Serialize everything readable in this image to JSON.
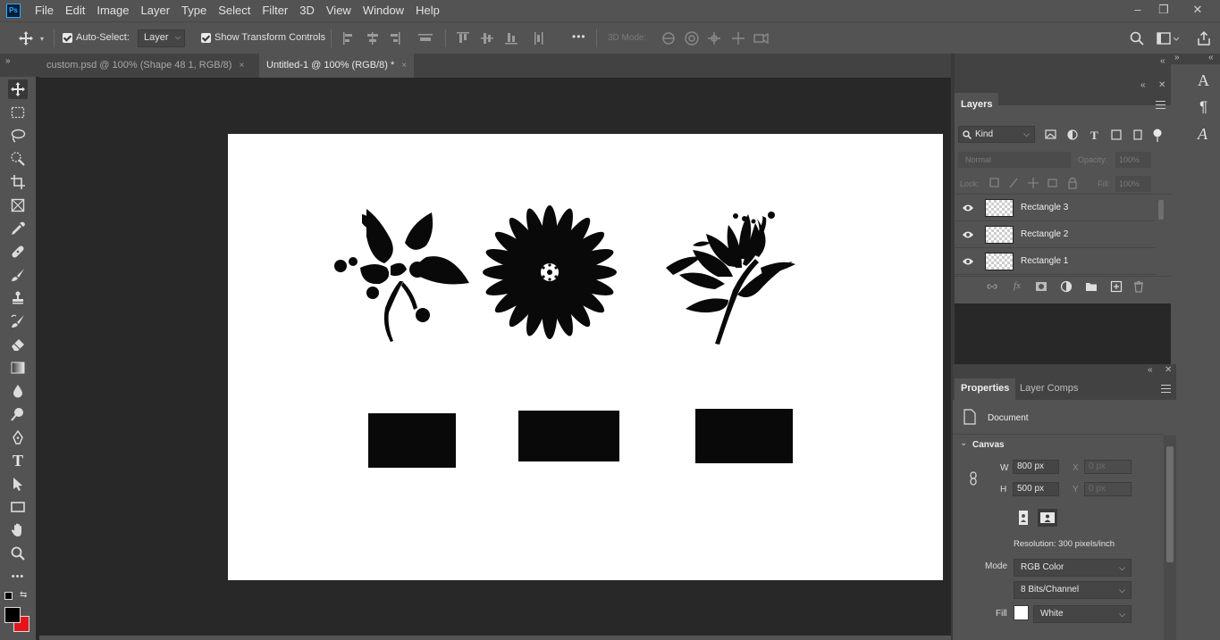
{
  "menubar": {
    "app_icon": "Ps",
    "items": [
      "File",
      "Edit",
      "Image",
      "Layer",
      "Type",
      "Select",
      "Filter",
      "3D",
      "View",
      "Window",
      "Help"
    ],
    "controls": [
      "minimize-icon",
      "restore-icon",
      "close-icon"
    ]
  },
  "options": {
    "auto_select_label": "Auto-Select:",
    "auto_select_checked": true,
    "auto_select_target": "Layer",
    "transform_label": "Show Transform Controls",
    "transform_checked": true,
    "more_label": "•••",
    "mode_3d_label": "3D Mode:"
  },
  "tabs": [
    {
      "label": "custom.psd @ 100% (Shape 48 1, RGB/8)",
      "close": "×",
      "active": false
    },
    {
      "label": "Untitled-1 @ 100% (RGB/8) *",
      "close": "×",
      "active": true
    }
  ],
  "toolbar": {
    "tools": [
      "move-tool",
      "marquee-tool",
      "lasso-tool",
      "quick-select-tool",
      "crop-tool",
      "frame-tool",
      "eyedropper-tool",
      "healing-tool",
      "brush-tool",
      "stamp-tool",
      "history-brush-tool",
      "eraser-tool",
      "gradient-tool",
      "blur-tool",
      "dodge-tool",
      "pen-tool",
      "type-tool",
      "path-select-tool",
      "rectangle-tool",
      "hand-tool",
      "zoom-tool",
      "more-tools"
    ],
    "type_glyph": "T",
    "more_glyph": "•••",
    "foreground_color": "#000000",
    "background_color": "#e3141b"
  },
  "document": {
    "shapes": [
      "leaf-flower-shape",
      "daisy-flower-shape",
      "lily-flower-shape"
    ],
    "rectangles": [
      "Rectangle 1",
      "Rectangle 2",
      "Rectangle 3"
    ],
    "rect_color": "#0a090a"
  },
  "layers": {
    "title": "Layers",
    "filter_kind": "Kind",
    "blend_mode": "Normal",
    "opacity_label": "Opacity:",
    "opacity_value": "100%",
    "lock_label": "Lock:",
    "fill_label": "Fill:",
    "fill_value": "100%",
    "items": [
      {
        "name": "Rectangle 3"
      },
      {
        "name": "Rectangle 2"
      },
      {
        "name": "Rectangle 1"
      }
    ],
    "fx_label": "fx"
  },
  "properties": {
    "tabs": [
      "Properties",
      "Layer Comps"
    ],
    "doc_label": "Document",
    "section": "Canvas",
    "w_label": "W",
    "w_value": "800 px",
    "h_label": "H",
    "h_value": "500 px",
    "x_label": "X",
    "x_value": "0 px",
    "y_label": "Y",
    "y_value": "0 px",
    "resolution": "Resolution: 300 pixels/inch",
    "mode_label": "Mode",
    "mode_value": "RGB Color",
    "depth_value": "8 Bits/Channel",
    "fill_label": "Fill",
    "fill_value": "White"
  },
  "right_strip": {
    "icons": [
      "character-icon",
      "paragraph-icon",
      "glyphs-icon"
    ],
    "char_glyph": "A",
    "para_glyph": "¶",
    "glyph_glyph": "A"
  }
}
